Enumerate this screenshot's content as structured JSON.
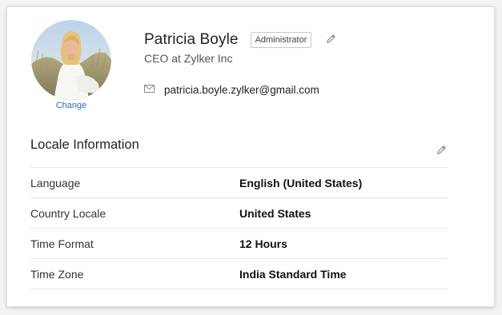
{
  "profile": {
    "change_label": "Change",
    "name": "Patricia Boyle",
    "role_badge": "Administrator",
    "title": "CEO at Zylker Inc",
    "email": "patricia.boyle.zylker@gmail.com"
  },
  "locale": {
    "section_title": "Locale Information",
    "rows": [
      {
        "label": "Language",
        "value": "English (United States)"
      },
      {
        "label": "Country Locale",
        "value": "United States"
      },
      {
        "label": "Time Format",
        "value": "12 Hours"
      },
      {
        "label": "Time Zone",
        "value": "India Standard Time"
      }
    ]
  },
  "colors": {
    "link": "#2a6ebb",
    "divider": "#e6e6e6"
  },
  "icons": {
    "profile_edit": "pencil-icon",
    "email": "envelope-icon",
    "locale_edit": "pencil-icon"
  }
}
